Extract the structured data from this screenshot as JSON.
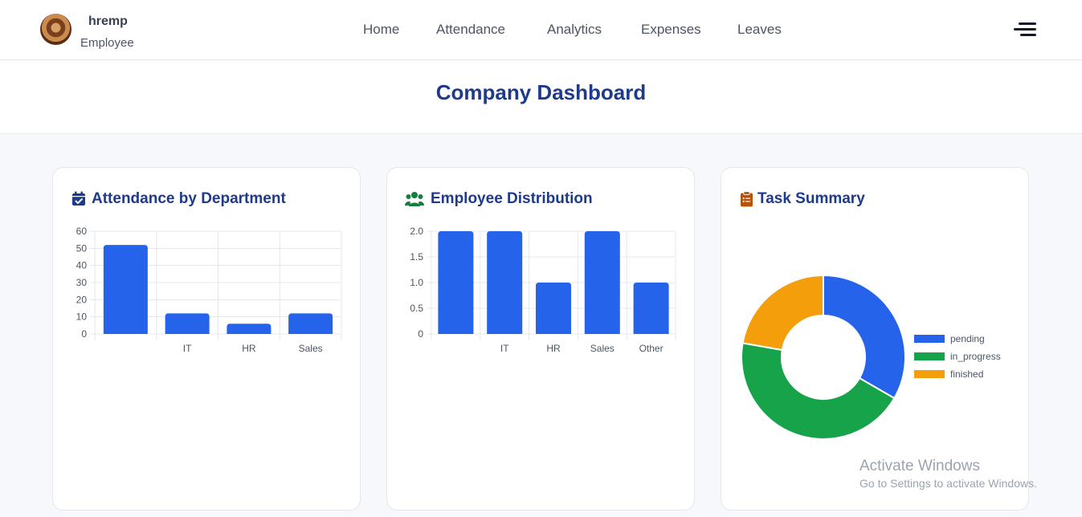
{
  "user": {
    "name": "hremp",
    "role": "Employee"
  },
  "nav": {
    "items": [
      {
        "label": "Home"
      },
      {
        "label": "Attendance"
      },
      {
        "label": "Analytics"
      },
      {
        "label": "Expenses"
      },
      {
        "label": "Leaves"
      }
    ]
  },
  "page": {
    "title": "Company Dashboard"
  },
  "cards": {
    "attendance": {
      "title": "Attendance by Department",
      "icon": "calendar-check-icon",
      "color": "#1e3a8a"
    },
    "employees": {
      "title": "Employee Distribution",
      "icon": "users-icon",
      "color": "#15803d"
    },
    "tasks": {
      "title": "Task Summary",
      "icon": "clipboard-list-icon",
      "color": "#b45309"
    }
  },
  "watermark": {
    "line1": "Activate Windows",
    "line2": "Go to Settings to activate Windows."
  },
  "colors": {
    "primary": "#2563eb",
    "green": "#16a34a",
    "orange": "#f59e0b",
    "title": "#1e3a8a"
  },
  "chart_data": [
    {
      "type": "bar",
      "categories": [
        "",
        "IT",
        "HR",
        "Sales"
      ],
      "values": [
        52,
        12,
        6,
        12
      ],
      "ylim": [
        0,
        60
      ],
      "yticks": [
        0,
        10,
        20,
        30,
        40,
        50,
        60
      ],
      "grid": true,
      "color": "#2563eb"
    },
    {
      "type": "bar",
      "categories": [
        "",
        "IT",
        "HR",
        "Sales",
        "Other"
      ],
      "values": [
        2,
        2,
        1,
        2,
        1
      ],
      "ylim": [
        0,
        2
      ],
      "yticks": [
        "0",
        "0.5",
        "1.0",
        "1.5",
        "2.0"
      ],
      "grid": true,
      "color": "#2563eb"
    },
    {
      "type": "pie",
      "donut": true,
      "labels": [
        "pending",
        "in_progress",
        "finished"
      ],
      "values": [
        3,
        4,
        2
      ],
      "colors": [
        "#2563eb",
        "#16a34a",
        "#f59e0b"
      ],
      "legend": "right"
    }
  ]
}
